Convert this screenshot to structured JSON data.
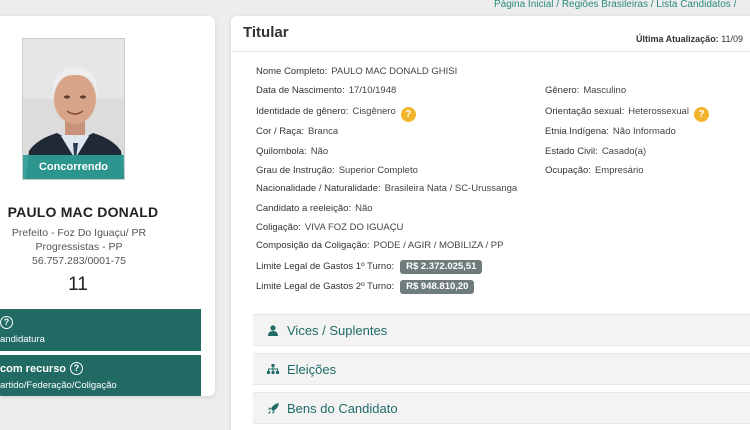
{
  "breadcrumb": "Página Inicial / Regiões Brasileiras / Lista Candidatos /",
  "candidate": {
    "status_label": "Concorrendo",
    "name": "PAULO MAC DONALD",
    "office_line": "Prefeito - Foz Do Iguaçu/ PR",
    "party_line": "Progressistas - PP",
    "cnpj": "56.757.283/0001-75",
    "number": "11"
  },
  "status_boxes": [
    {
      "title": "",
      "subtitle": "andidatura"
    },
    {
      "title": "com recurso",
      "subtitle": "artido/Federação/Coligação"
    }
  ],
  "titular": {
    "title": "Titular",
    "update_label": "Última Atualização:",
    "update_value": "11/09",
    "fields": {
      "nome_completo": {
        "label": "Nome Completo:",
        "value": "PAULO MAC DONALD GHISI"
      },
      "data_nascimento": {
        "label": "Data de Nascimento:",
        "value": "17/10/1948"
      },
      "genero": {
        "label": "Gênero:",
        "value": "Masculino"
      },
      "identidade_genero": {
        "label": "Identidade de gênero:",
        "value": "Cisgênero"
      },
      "orientacao_sexual": {
        "label": "Orientação sexual:",
        "value": "Heterossexual"
      },
      "cor_raca": {
        "label": "Cor / Raça:",
        "value": "Branca"
      },
      "etnia_indigena": {
        "label": "Etnia Indígena:",
        "value": "Não Informado"
      },
      "quilombola": {
        "label": "Quilombola:",
        "value": "Não"
      },
      "estado_civil": {
        "label": "Estado Civil:",
        "value": "Casado(a)"
      },
      "grau_instrucao": {
        "label": "Grau de Instrução:",
        "value": "Superior Completo"
      },
      "ocupacao": {
        "label": "Ocupação:",
        "value": "Empresário"
      },
      "nacionalidade": {
        "label": "Nacionalidade / Naturalidade:",
        "value": "Brasileira Nata / SC-Urussanga"
      },
      "reeleicao": {
        "label": "Candidato a reeleição:",
        "value": "Não"
      },
      "coligacao": {
        "label": "Coligação:",
        "value": "VIVA FOZ DO IGUAÇU"
      },
      "composicao": {
        "label": "Composição da Coligação:",
        "value": "PODE / AGIR / MOBILIZA / PP"
      },
      "limite_1": {
        "label": "Limite Legal de Gastos 1º Turno:",
        "value": "R$ 2.372.025,51"
      },
      "limite_2": {
        "label": "Limite Legal de Gastos 2º Turno:",
        "value": "R$ 948.810,20"
      }
    },
    "help_symbol": "?"
  },
  "accordions": [
    {
      "label": "Vices / Suplentes",
      "icon": "user-icon"
    },
    {
      "label": "Eleições",
      "icon": "sitemap-icon"
    },
    {
      "label": "Bens do Candidato",
      "icon": "rocket-icon"
    }
  ],
  "colors": {
    "accent_teal": "#226a64",
    "status_strip": "#2e9e96",
    "badge_gray": "#707b7c",
    "help_yellow": "#f2b42a",
    "link_green": "#2a8a78"
  }
}
